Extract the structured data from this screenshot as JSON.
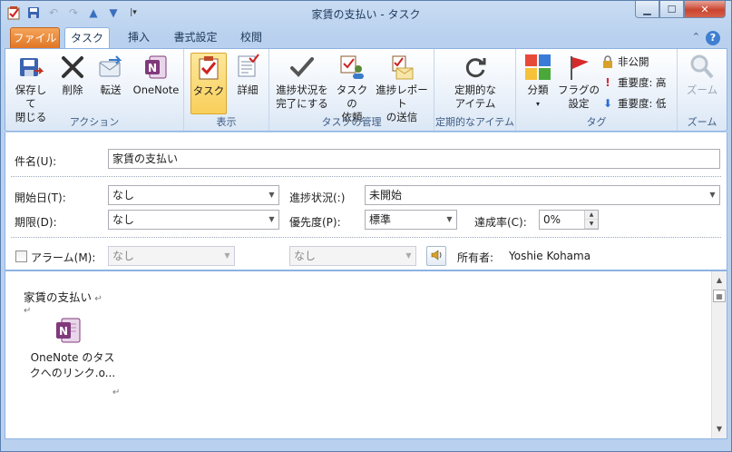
{
  "window": {
    "title": "家賃の支払い - タスク"
  },
  "tabs": [
    {
      "label": "ファイル"
    },
    {
      "label": "タスク"
    },
    {
      "label": "挿入"
    },
    {
      "label": "書式設定"
    },
    {
      "label": "校閲"
    }
  ],
  "ribbon": {
    "actions": {
      "save_close": [
        "保存して",
        "閉じる"
      ],
      "delete": "削除",
      "forward": "転送",
      "onenote": "OneNote",
      "group_label": "アクション"
    },
    "show": {
      "task": "タスク",
      "details": "詳細",
      "group_label": "表示"
    },
    "manage": {
      "mark_complete": [
        "進捗状況を",
        "完了にする"
      ],
      "assign": [
        "タスクの",
        "依頼"
      ],
      "send_report": [
        "進捗レポート",
        "の送信"
      ],
      "group_label": "タスクの管理"
    },
    "recurrence": {
      "recurrence": [
        "定期的な",
        "アイテム"
      ],
      "group_label": "定期的なアイテム"
    },
    "tags": {
      "categorize": "分類",
      "follow_up": [
        "フラグの",
        "設定"
      ],
      "private": "非公開",
      "high": "重要度: 高",
      "low": "重要度: 低",
      "group_label": "タグ"
    },
    "zoom": {
      "zoom": "ズーム",
      "group_label": "ズーム"
    }
  },
  "form": {
    "subject_label": "件名(U):",
    "subject_value": "家賃の支払い",
    "start_label": "開始日(T):",
    "start_value": "なし",
    "due_label": "期限(D):",
    "due_value": "なし",
    "status_label": "進捗状況(:)",
    "status_value": "未開始",
    "priority_label": "優先度(P):",
    "priority_value": "標準",
    "percent_label": "達成率(C):",
    "percent_value": "0%",
    "reminder_label": "アラーム(M):",
    "reminder_date": "なし",
    "reminder_time": "なし",
    "owner_label": "所有者:",
    "owner_value": "Yoshie Kohama"
  },
  "body": {
    "text": "家賃の支払い",
    "attachment_line1": "OneNote のタス",
    "attachment_line2": "クへのリンク.o..."
  },
  "colors": {
    "accent": "#3f7fd1",
    "file_tab": "#e07625",
    "onenote": "#80397b"
  }
}
